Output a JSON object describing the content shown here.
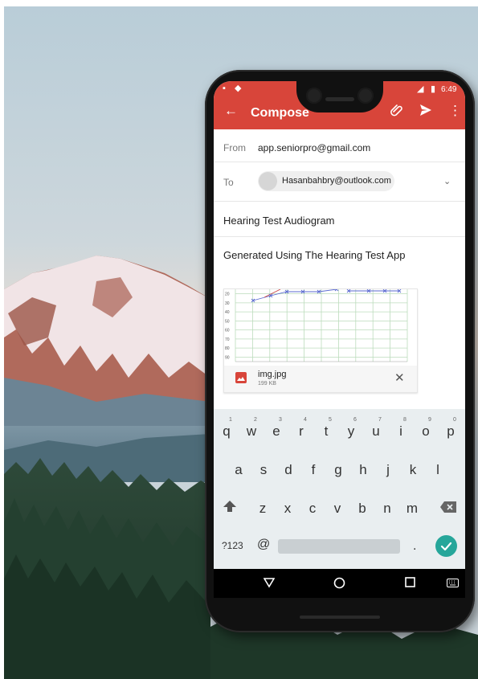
{
  "status_bar": {
    "time": "6:49",
    "left_icon_1": "notification-icon",
    "left_icon_2": "android-icon",
    "signal_icon": "signal-icon",
    "battery_icon": "battery-icon"
  },
  "app_bar": {
    "title": "Compose",
    "back_icon": "back-arrow-icon",
    "attach_icon": "attach-icon",
    "send_icon": "send-icon",
    "more_icon": "more-vert-icon",
    "color": "#d8453a"
  },
  "email": {
    "from_label": "From",
    "from_value": "app.seniorpro@gmail.com",
    "to_label": "To",
    "to_chip": "Hasanbahbry@outlook.com",
    "subject": "Hearing Test Audiogram",
    "body": "Generated Using The Hearing Test App"
  },
  "attachment": {
    "file_name": "img.jpg",
    "file_size": "199 KB",
    "file_icon": "image-file-icon",
    "remove_icon": "close-icon",
    "preview_y_ticks": [
      "20",
      "30",
      "40",
      "50",
      "60",
      "70",
      "80",
      "90"
    ]
  },
  "keyboard": {
    "row1": [
      "q",
      "w",
      "e",
      "r",
      "t",
      "y",
      "u",
      "i",
      "o",
      "p"
    ],
    "row1_hints": [
      "1",
      "2",
      "3",
      "4",
      "5",
      "6",
      "7",
      "8",
      "9",
      "0"
    ],
    "row2": [
      "a",
      "s",
      "d",
      "f",
      "g",
      "h",
      "j",
      "k",
      "l"
    ],
    "row3": [
      "z",
      "x",
      "c",
      "v",
      "b",
      "n",
      "m"
    ],
    "shift_icon": "shift-icon",
    "backspace_icon": "backspace-icon",
    "sym_key": "?123",
    "at_key": "@",
    "period_key": ".",
    "enter_icon": "check-icon",
    "enter_color": "#26a69a"
  },
  "nav_bar": {
    "back_icon": "nav-back-icon",
    "home_icon": "nav-home-icon",
    "recents_icon": "nav-recents-icon",
    "keyboard_icon": "keyboard-icon"
  }
}
